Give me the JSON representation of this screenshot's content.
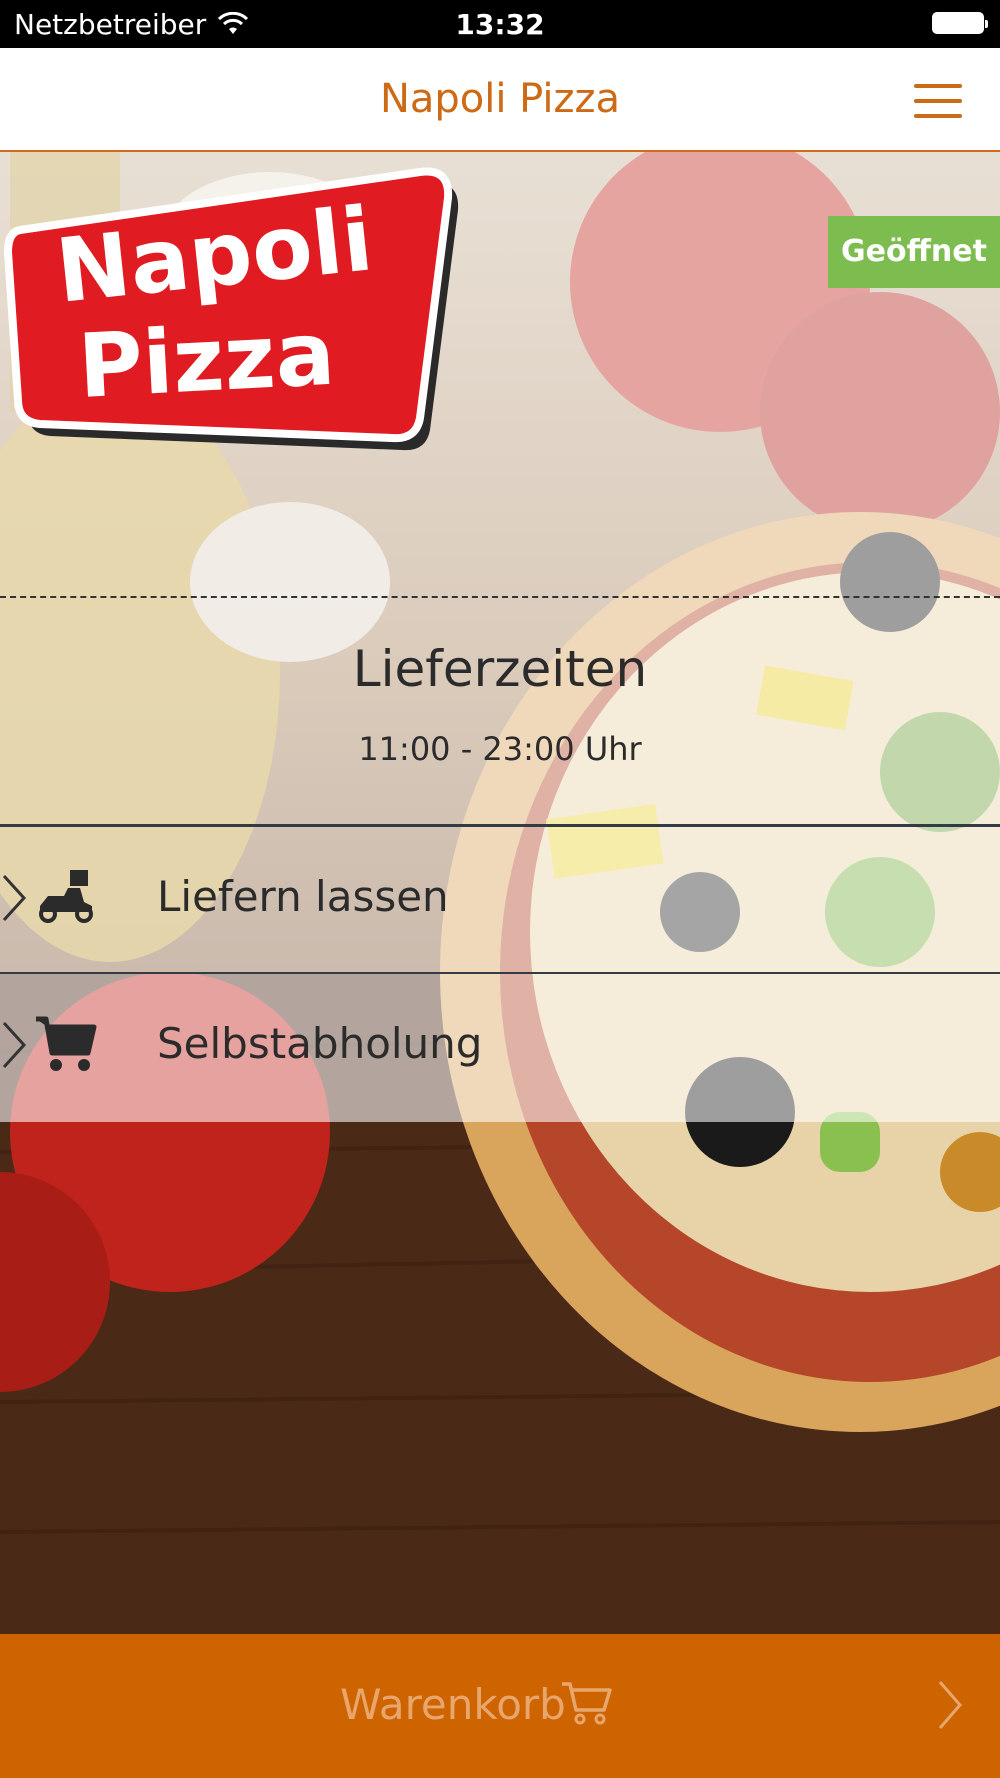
{
  "status_bar": {
    "carrier": "Netzbetreiber",
    "time": "13:32"
  },
  "nav": {
    "title": "Napoli Pizza"
  },
  "badge": {
    "status": "Geöffnet",
    "color": "#7dbd4f"
  },
  "logo": {
    "line1": "Napoli",
    "line2": "Pizza"
  },
  "hours": {
    "title": "Lieferzeiten",
    "value": "11:00 - 23:00 Uhr"
  },
  "options": [
    {
      "label": "Liefern lassen",
      "icon": "delivery-scooter-icon"
    },
    {
      "label": "Selbstabholung",
      "icon": "shopping-cart-icon"
    }
  ],
  "cart": {
    "label": "Warenkorb",
    "icon": "cart-icon"
  },
  "colors": {
    "accent": "#cd6a16",
    "cart_bar": "#cd6400",
    "logo_red": "#e01b22"
  }
}
